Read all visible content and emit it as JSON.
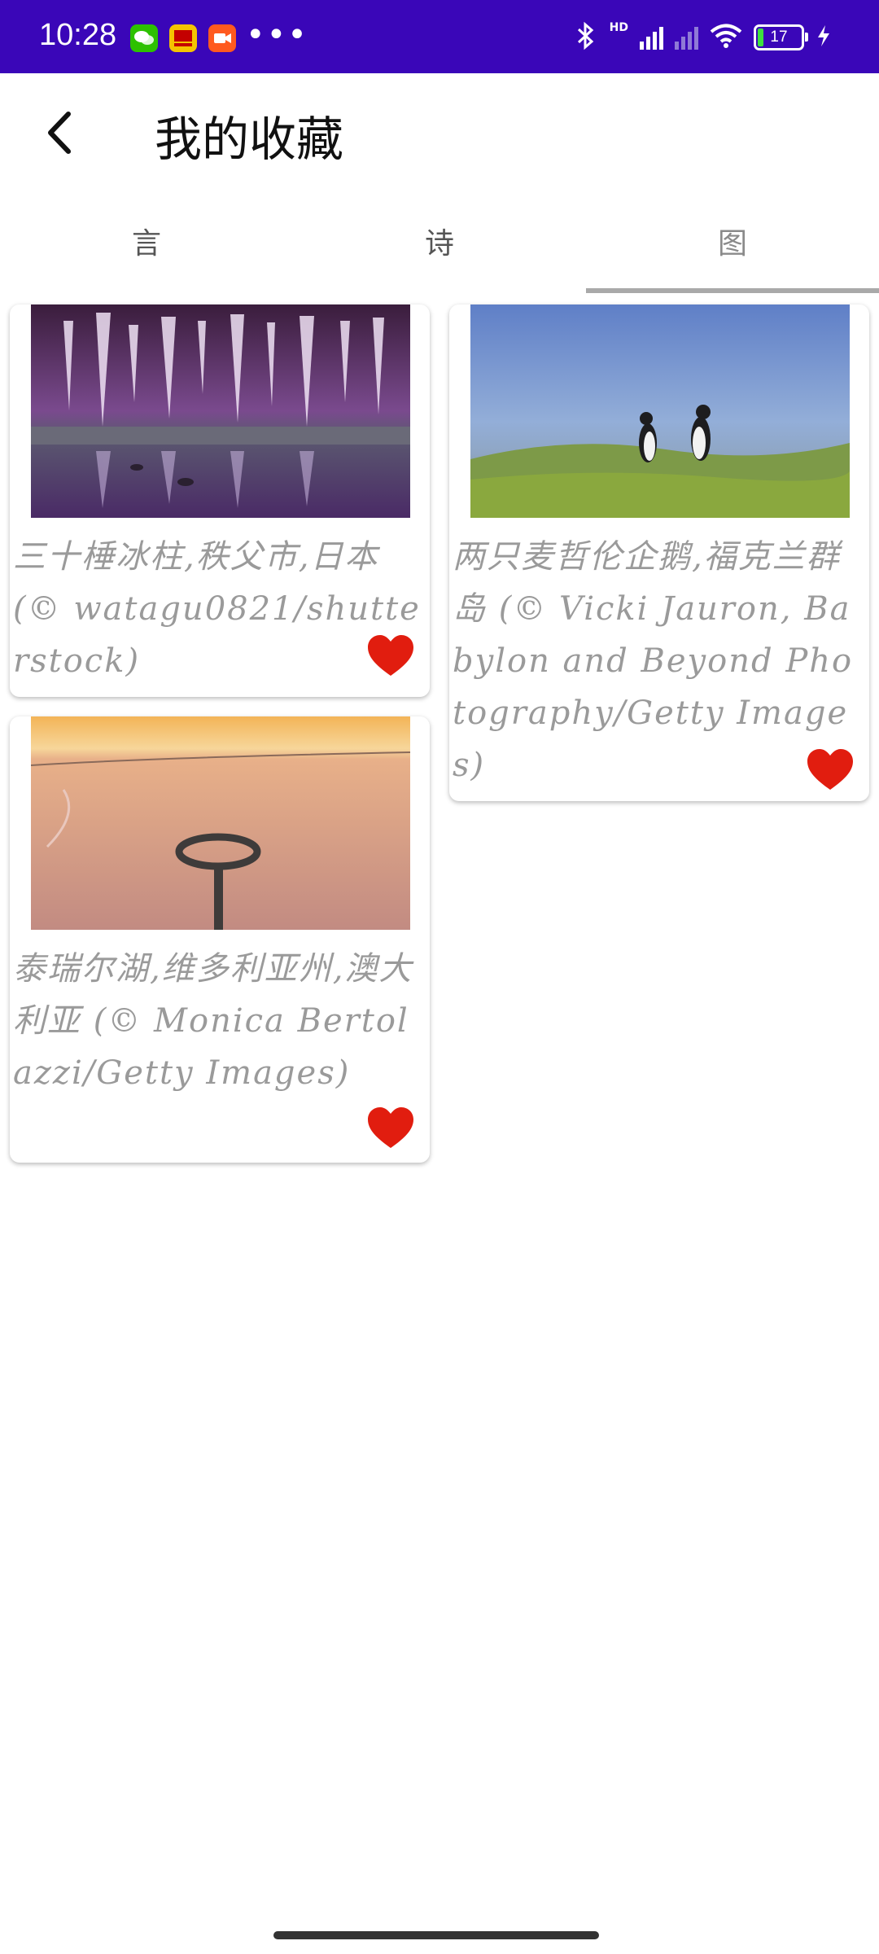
{
  "status_bar": {
    "time": "10:28",
    "hd": "HD",
    "battery": "17",
    "bg_color": "#3a06b8"
  },
  "header": {
    "back_icon": "chevron-left-icon",
    "title": "我的收藏"
  },
  "tabs": [
    {
      "label": "言",
      "active": false
    },
    {
      "label": "诗",
      "active": false
    },
    {
      "label": "图",
      "active": true
    }
  ],
  "favorites": [
    {
      "caption": "三十棰冰柱,秩父市,日本 (© watagu0821/shutterstock)",
      "image": "purple-icicle-cave-reflection",
      "liked": true
    },
    {
      "caption": "两只麦哲伦企鹅,福克兰群岛 (© Vicki Jauron, Babylon and Beyond Photography/Getty Images)",
      "image": "two-penguins-grass",
      "liked": true
    },
    {
      "caption": "泰瑞尔湖,维多利亚州,澳大利亚 (© Monica Bertolazzi/Getty Images)",
      "image": "salt-lake-circular-jetty",
      "liked": true
    }
  ],
  "colors": {
    "heart": "#e11d0f",
    "caption": "#9a9a9a"
  }
}
